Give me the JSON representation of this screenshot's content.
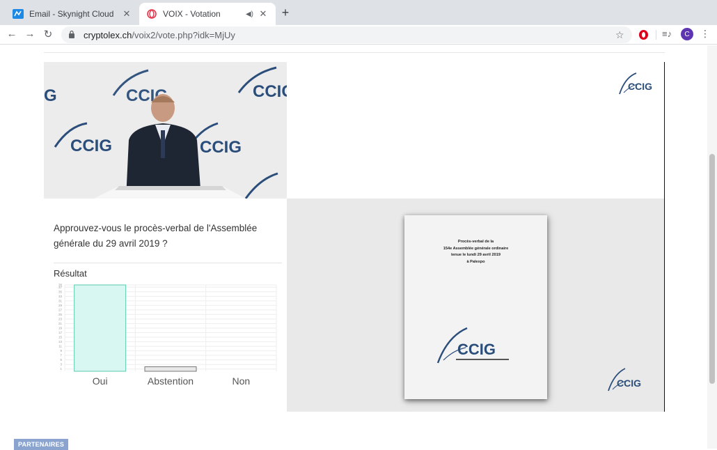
{
  "browser": {
    "tabs": [
      {
        "title": "Email - Skynight Cloud",
        "icon": "skynight-icon",
        "active": false
      },
      {
        "title": "VOIX - Votation",
        "icon": "voix-spiral-icon",
        "active": true
      }
    ],
    "url_host": "cryptolex.ch",
    "url_path": "/voix2/vote.php?idk=MjUy",
    "profile_initial": "C"
  },
  "logo_text": "CCIG",
  "question": {
    "text": "Approuvez-vous le procès-verbal de l'Assemblée générale du 29 avril 2019 ?",
    "result_title": "Résultat"
  },
  "chart_data": {
    "type": "bar",
    "categories": [
      "Oui",
      "Abstention",
      "Non"
    ],
    "values": [
      38,
      2,
      0
    ],
    "ylim": [
      0,
      38
    ],
    "yticks": [
      1,
      3,
      5,
      7,
      9,
      11,
      13,
      15,
      17,
      19,
      21,
      23,
      25,
      27,
      29,
      31,
      33,
      35,
      37,
      38
    ],
    "grid": true,
    "colors": [
      "#d9f7f2",
      "#e8e8e8",
      "#e8e8e8"
    ],
    "edge_colors": [
      "#5ccab0",
      "#777777",
      "#777777"
    ]
  },
  "doc": {
    "lines": [
      "Procès-verbal de la",
      "154e Assemblée générale ordinaire",
      "tenue le lundi 29 avril 2019",
      "à Palexpo"
    ]
  },
  "color_bars": [
    "#9aa0a6",
    "#1f77b4",
    "#2bb6e0"
  ],
  "partners_label": "PARTENAIRES"
}
